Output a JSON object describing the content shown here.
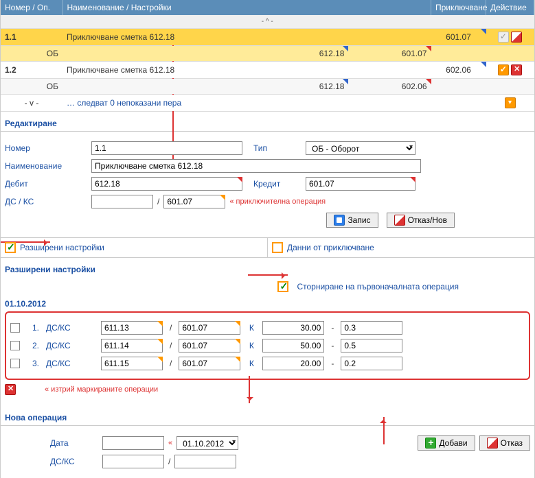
{
  "header": {
    "col_num": "Номер / Оп.",
    "col_name": "Наименование / Настройки",
    "col_close": "Приключване",
    "col_action": "Действие"
  },
  "expander_up": "- ^ -",
  "expander_down": "- v -",
  "rows": [
    {
      "num": "1.1",
      "name": "Приключване сметка 612.18",
      "close": "601.07",
      "ob": "ОБ",
      "ob_debit": "612.18",
      "ob_credit": "601.07"
    },
    {
      "num": "1.2",
      "name": "Приключване сметка 612.18",
      "close": "602.06",
      "ob": "ОБ",
      "ob_debit": "612.18",
      "ob_credit": "602.06"
    }
  ],
  "more_rows": "… следват 0 непоказани пера",
  "edit": {
    "title": "Редактиране",
    "num_label": "Номер",
    "num_value": "1.1",
    "type_label": "Тип",
    "type_value": "ОБ - Оборот",
    "name_label": "Наименование",
    "name_value": "Приключване сметка 612.18",
    "debit_label": "Дебит",
    "debit_value": "612.18",
    "credit_label": "Кредит",
    "credit_value": "601.07",
    "dsks_label": "ДС / КС",
    "dsks_value": "",
    "dsks_value2": "601.07",
    "close_note": "« приключителна операция",
    "save": "Запис",
    "cancel": "Отказ/Нов",
    "advanced": "Разширени настройки",
    "from_close": "Данни от приключване"
  },
  "adv": {
    "title": "Разширени настройки",
    "storno": "Сторниране на първоначалната операция",
    "date": "01.10.2012",
    "dsks": "ДС/КС",
    "lines": [
      {
        "n": "1.",
        "a": "611.13",
        "b": "601.07",
        "k": "К",
        "amt": "30.00",
        "coef": "0.3"
      },
      {
        "n": "2.",
        "a": "611.14",
        "b": "601.07",
        "k": "К",
        "amt": "50.00",
        "coef": "0.5"
      },
      {
        "n": "3.",
        "a": "611.15",
        "b": "601.07",
        "k": "К",
        "amt": "20.00",
        "coef": "0.2"
      }
    ],
    "delete_marked": "« изтрий маркираните операции"
  },
  "newop": {
    "title": "Нова операция",
    "date_label": "Дата",
    "date_value": "01.10.2012",
    "date_prefix": "«",
    "dsks_label": "ДС/КС",
    "add": "Добави",
    "cancel": "Отказ"
  }
}
